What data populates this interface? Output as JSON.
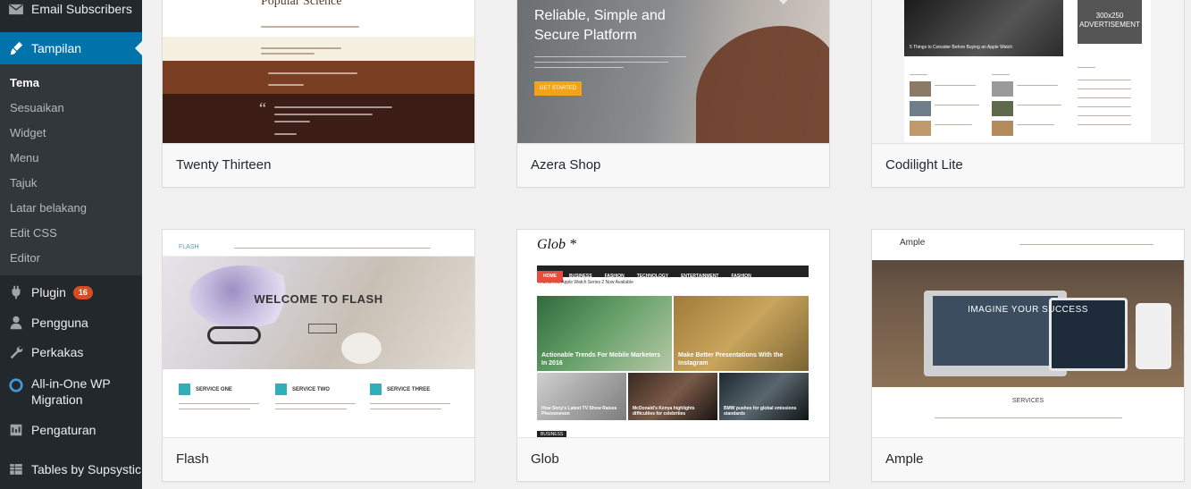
{
  "sidebar": {
    "items": [
      {
        "label": "Email Subscribers",
        "icon": "envelope-icon"
      },
      {
        "label": "Tampilan",
        "icon": "paintbrush-icon"
      },
      {
        "label": "Plugin",
        "icon": "plug-icon",
        "badge": "16"
      },
      {
        "label": "Pengguna",
        "icon": "user-icon"
      },
      {
        "label": "Perkakas",
        "icon": "wrench-icon"
      },
      {
        "label": "All-in-One WP Migration",
        "icon": "migration-icon"
      },
      {
        "label": "Pengaturan",
        "icon": "settings-icon"
      },
      {
        "label": "Tables by Supsystic",
        "icon": "table-icon"
      }
    ],
    "submenu": [
      "Tema",
      "Sesuaikan",
      "Widget",
      "Menu",
      "Tajuk",
      "Latar belakang",
      "Edit CSS",
      "Editor"
    ],
    "accent_color": "#0073aa",
    "badge_color": "#d54e21"
  },
  "themes": [
    {
      "name": "Twenty Thirteen",
      "preview": {
        "title": "Popular Science"
      }
    },
    {
      "name": "Azera Shop",
      "preview": {
        "headline": "Reliable, Simple and Secure Platform",
        "button": "GET STARTED"
      }
    },
    {
      "name": "Codilight Lite",
      "preview": {
        "ad": "300x250 ADVERTISEMENT",
        "headline": "5 Things to Consider Before Buying an Apple Watch"
      }
    },
    {
      "name": "Flash",
      "preview": {
        "logo": "FLASH",
        "hero_title": "WELCOME TO FLASH",
        "services": [
          "SERVICE ONE",
          "SERVICE TWO",
          "SERVICE THREE"
        ]
      }
    },
    {
      "name": "Glob",
      "preview": {
        "logo": "Glob *",
        "nav": [
          "HOME",
          "BUSINESS",
          "FASHION",
          "TECHNOLOGY",
          "ENTERTAINMENT",
          "FASHION"
        ],
        "ticker_label": "TRENDING",
        "ticker_text": "Apple Watch Series 2 Now Available",
        "posts": [
          "Actionable Trends For Mobile Marketers In 2016",
          "Make Better Presentations With the Instagram",
          "How Sony's Latest TV Show Raises Phenomenon",
          "McDonald's Kenya highlights difficulties for celebrities",
          "BMW pushes for global emissions standards"
        ],
        "section": "BUSINESS"
      }
    },
    {
      "name": "Ample",
      "preview": {
        "logo": "Ample",
        "hero_text": "IMAGINE YOUR SUCCESS",
        "section": "SERVICES"
      }
    }
  ]
}
